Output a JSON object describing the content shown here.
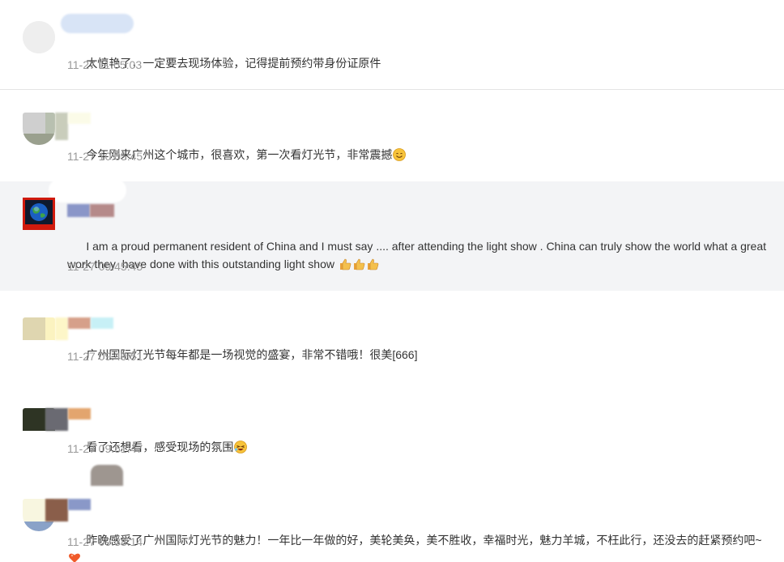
{
  "comments": [
    {
      "text": "太惊艳了，一定要去现场体验，记得提前预约带身份证原件",
      "time": "11-27 11:05:03",
      "emoji": []
    },
    {
      "text": "今年刚来广州这个城市，很喜欢，第一次看灯光节，非常震撼",
      "time": "11-27 10:05:45",
      "emoji": [
        "smiling-face-icon"
      ]
    },
    {
      "text": "I am a proud permanent resident of China and I must say .... after attending the light show . China can truly show the world what a great work they  have done with this outstanding light show ",
      "time": "11-27 09:45:45",
      "emoji": [
        "thumbs-up-icon",
        "thumbs-up-icon",
        "thumbs-up-icon"
      ]
    },
    {
      "text": "广州国际灯光节每年都是一场视觉的盛宴，非常不错哦！很美[666]",
      "time": "11-27 09:49:51",
      "emoji": []
    },
    {
      "text": "看了还想看，感受现场的氛围",
      "time": "11-27 09:51:47",
      "emoji": [
        "laughing-face-icon"
      ]
    },
    {
      "text": "昨晚感受了广州国际灯光节的魅力！一年比一年做的好，美轮美奂，美不胜收，幸福时光，魅力羊城，不枉此行，还没去的赶紧预约吧~",
      "time": "11-27 09:38:14",
      "emoji": [
        "heart-icon"
      ]
    }
  ]
}
